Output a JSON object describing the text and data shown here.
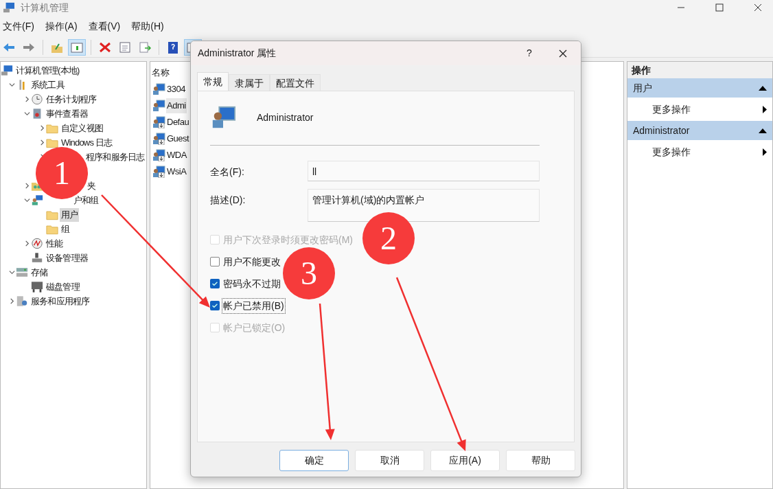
{
  "window": {
    "title": "计算机管理"
  },
  "menu": [
    "文件(F)",
    "操作(A)",
    "查看(V)",
    "帮助(H)"
  ],
  "toolbar": [
    {
      "kind": "back"
    },
    {
      "kind": "forward"
    },
    {
      "kind": "sep"
    },
    {
      "kind": "up"
    },
    {
      "kind": "pane",
      "selected": true
    },
    {
      "kind": "sep"
    },
    {
      "kind": "delete"
    },
    {
      "kind": "properties"
    },
    {
      "kind": "export"
    },
    {
      "kind": "sep"
    },
    {
      "kind": "help"
    },
    {
      "kind": "pane2",
      "selected": true
    }
  ],
  "tree": [
    {
      "label": "计算机管理(本地)",
      "kind": "computer",
      "selected": false,
      "children": [
        {
          "label": "系统工具",
          "kind": "tools",
          "expanded": true,
          "selected": false,
          "children": [
            {
              "label": "任务计划程序",
              "kind": "clock",
              "expanded": false,
              "selected": false
            },
            {
              "label": "事件查看器",
              "kind": "event",
              "expanded": true,
              "selected": false,
              "children": [
                {
                  "label": "自定义视图",
                  "kind": "folder",
                  "expanded": false,
                  "selected": false
                },
                {
                  "label": "Windows 日志",
                  "kind": "folder",
                  "expanded": false,
                  "selected": false
                },
                {
                  "label": "程序和服务日志",
                  "kind": "plain",
                  "expanded": false,
                  "selected": false
                }
              ]
            },
            {
              "label": "夹",
              "kind": "share",
              "expanded": false,
              "selected": false
            },
            {
              "label": "户和组",
              "kind": "users",
              "expanded": true,
              "selected": false,
              "children": [
                {
                  "label": "用户",
                  "kind": "folder",
                  "selected": true
                },
                {
                  "label": "组",
                  "kind": "folder",
                  "selected": false
                }
              ]
            },
            {
              "label": "性能",
              "kind": "perf",
              "expanded": false,
              "selected": false
            },
            {
              "label": "设备管理器",
              "kind": "device",
              "selected": false
            }
          ]
        },
        {
          "label": "存储",
          "kind": "storage",
          "expanded": true,
          "selected": false,
          "children": [
            {
              "label": "磁盘管理",
              "kind": "disk",
              "selected": false
            }
          ]
        },
        {
          "label": "服务和应用程序",
          "kind": "services",
          "expanded": false,
          "selected": false
        }
      ]
    }
  ],
  "list": {
    "column": "名称",
    "rows": [
      {
        "name": "3304",
        "selected": false,
        "disabled": false
      },
      {
        "name": "Admi",
        "selected": true,
        "disabled": false
      },
      {
        "name": "Defau",
        "selected": false,
        "disabled": true
      },
      {
        "name": "Guest",
        "selected": false,
        "disabled": true
      },
      {
        "name": "WDA",
        "selected": false,
        "disabled": true
      },
      {
        "name": "WsiA",
        "selected": false,
        "disabled": true
      }
    ]
  },
  "actions": {
    "title": "操作",
    "sections": [
      {
        "title": "用户",
        "items": [
          "更多操作"
        ]
      },
      {
        "title": "Administrator",
        "items": [
          "更多操作"
        ]
      }
    ]
  },
  "dialog": {
    "title": "Administrator 属性",
    "help": "?",
    "tabs": [
      {
        "label": "常规",
        "selected": true
      },
      {
        "label": "隶属于",
        "selected": false
      },
      {
        "label": "配置文件",
        "selected": false
      }
    ],
    "user": "Administrator",
    "fields": [
      {
        "label": "全名(F):",
        "value": "ll",
        "kind": "line"
      },
      {
        "label": "描述(D):",
        "value": "管理计算机(域)的内置帐户",
        "kind": "area"
      }
    ],
    "checkboxes": [
      {
        "label": "用户下次登录时须更改密码(M)",
        "checked": false,
        "disabled": true,
        "focused": false
      },
      {
        "label": "用户不能更改",
        "checked": false,
        "disabled": false,
        "focused": false
      },
      {
        "label": "密码永不过期",
        "checked": true,
        "disabled": false,
        "focused": false
      },
      {
        "label": "帐户已禁用(B)",
        "checked": true,
        "disabled": false,
        "focused": true
      },
      {
        "label": "帐户已锁定(O)",
        "checked": false,
        "disabled": true,
        "focused": false
      }
    ],
    "buttons": [
      {
        "label": "确定",
        "default": true
      },
      {
        "label": "取消",
        "default": false
      },
      {
        "label": "应用(A)",
        "default": false
      },
      {
        "label": "帮助",
        "default": false
      }
    ]
  },
  "annotations": [
    {
      "number": "1"
    },
    {
      "number": "2"
    },
    {
      "number": "3"
    }
  ]
}
